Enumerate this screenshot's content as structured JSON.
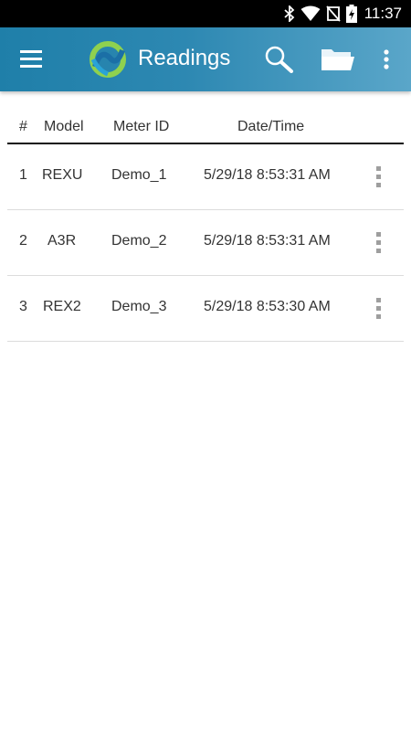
{
  "status_bar": {
    "time": "11:37",
    "icons": [
      "bluetooth-icon",
      "wifi-icon",
      "no-sim-icon",
      "battery-charging-icon"
    ]
  },
  "app_bar": {
    "title": "Readings",
    "colors": {
      "start": "#1f7fa9",
      "end": "#5aa6c9"
    },
    "icons": [
      "menu-icon",
      "app-logo",
      "search-icon",
      "folder-icon",
      "overflow-menu-icon"
    ]
  },
  "table": {
    "headers": [
      "#",
      "Model",
      "Meter ID",
      "Date/Time"
    ],
    "rows": [
      {
        "num": "1",
        "model": "REXU",
        "meter_id": "Demo_1",
        "datetime": "5/29/18 8:53:31 AM"
      },
      {
        "num": "2",
        "model": "A3R",
        "meter_id": "Demo_2",
        "datetime": "5/29/18 8:53:31 AM"
      },
      {
        "num": "3",
        "model": "REX2",
        "meter_id": "Demo_3",
        "datetime": "5/29/18 8:53:30 AM"
      }
    ]
  }
}
